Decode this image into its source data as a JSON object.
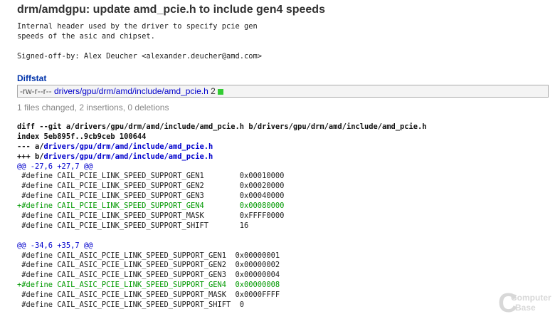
{
  "commit": {
    "title": "drm/amdgpu: update amd_pcie.h to include gen4 speeds",
    "message": "Internal header used by the driver to specify pcie gen\nspeeds of the asic and chipset.\n\nSigned-off-by: Alex Deucher <alexander.deucher@amd.com>"
  },
  "diffstat": {
    "header": "Diffstat",
    "mode": "-rw-r--r--",
    "file": "drivers/gpu/drm/amd/include/amd_pcie.h",
    "changes": "2",
    "summary": "1 files changed, 2 insertions, 0 deletions",
    "add_color": "#33cc33"
  },
  "diff": {
    "git_line_prefix": "diff --git ",
    "git_line_a": "a/drivers/gpu/drm/amd/include/amd_pcie.h",
    "git_line_b": " b/drivers/gpu/drm/amd/include/amd_pcie.h",
    "index_line": "index 5eb895f..9cb9ceb 100644",
    "old_prefix": "--- a/",
    "old_file": "drivers/gpu/drm/amd/include/amd_pcie.h",
    "new_prefix": "+++ b/",
    "new_file": "drivers/gpu/drm/amd/include/amd_pcie.h",
    "hunks": [
      {
        "header": "@@ -27,6 +27,7 @@",
        "lines": [
          {
            "type": "ctx",
            "text": " #define CAIL_PCIE_LINK_SPEED_SUPPORT_GEN1        0x00010000"
          },
          {
            "type": "ctx",
            "text": " #define CAIL_PCIE_LINK_SPEED_SUPPORT_GEN2        0x00020000"
          },
          {
            "type": "ctx",
            "text": " #define CAIL_PCIE_LINK_SPEED_SUPPORT_GEN3        0x00040000"
          },
          {
            "type": "add",
            "text": "+#define CAIL_PCIE_LINK_SPEED_SUPPORT_GEN4        0x00080000"
          },
          {
            "type": "ctx",
            "text": " #define CAIL_PCIE_LINK_SPEED_SUPPORT_MASK        0xFFFF0000"
          },
          {
            "type": "ctx",
            "text": " #define CAIL_PCIE_LINK_SPEED_SUPPORT_SHIFT       16"
          }
        ]
      },
      {
        "header": "@@ -34,6 +35,7 @@",
        "lines": [
          {
            "type": "ctx",
            "text": " #define CAIL_ASIC_PCIE_LINK_SPEED_SUPPORT_GEN1  0x00000001"
          },
          {
            "type": "ctx",
            "text": " #define CAIL_ASIC_PCIE_LINK_SPEED_SUPPORT_GEN2  0x00000002"
          },
          {
            "type": "ctx",
            "text": " #define CAIL_ASIC_PCIE_LINK_SPEED_SUPPORT_GEN3  0x00000004"
          },
          {
            "type": "add",
            "text": "+#define CAIL_ASIC_PCIE_LINK_SPEED_SUPPORT_GEN4  0x00000008"
          },
          {
            "type": "ctx",
            "text": " #define CAIL_ASIC_PCIE_LINK_SPEED_SUPPORT_MASK  0x0000FFFF"
          },
          {
            "type": "ctx",
            "text": " #define CAIL_ASIC_PCIE_LINK_SPEED_SUPPORT_SHIFT  0"
          }
        ]
      }
    ]
  },
  "watermark": {
    "line1": "Computer",
    "line2": "Base"
  }
}
